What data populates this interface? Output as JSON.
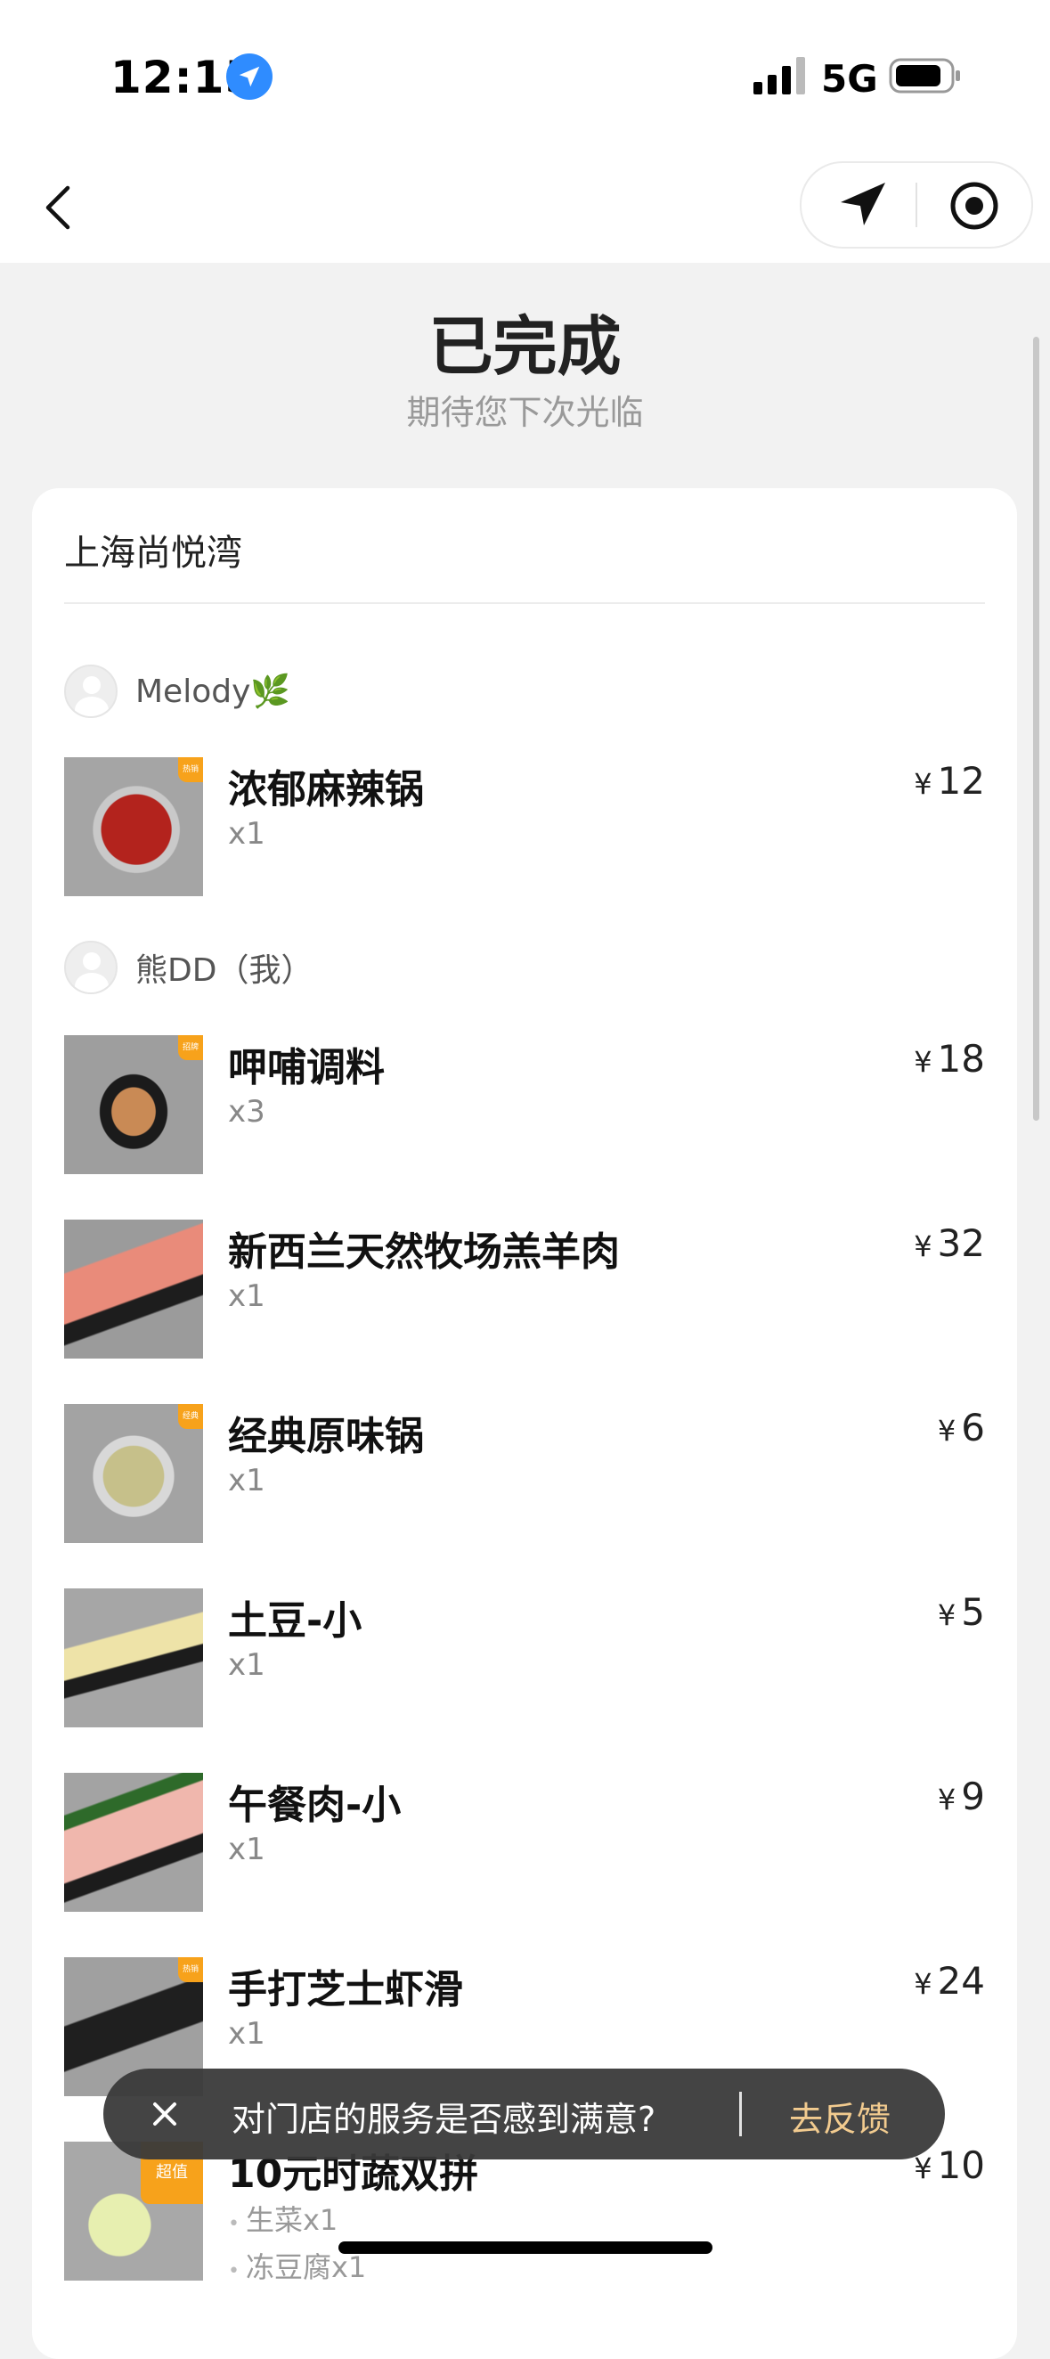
{
  "status": {
    "time": "12:15",
    "network": "5G"
  },
  "header": {
    "title": "已完成",
    "subtitle": "期待您下次光临"
  },
  "store": {
    "name": "上海尚悦湾"
  },
  "users": [
    {
      "name": "Melody🌿"
    },
    {
      "name": "熊DD（我）"
    }
  ],
  "currency": "¥",
  "items": [
    {
      "name": "浓郁麻辣锅",
      "qty": "x1",
      "price": "12",
      "tag": "热销"
    },
    {
      "name": "呷哺调料",
      "qty": "x3",
      "price": "18",
      "tag": "招牌"
    },
    {
      "name": "新西兰天然牧场羔羊肉",
      "qty": "x1",
      "price": "32"
    },
    {
      "name": "经典原味锅",
      "qty": "x1",
      "price": "6",
      "tag": "经典"
    },
    {
      "name": "土豆-小",
      "qty": "x1",
      "price": "5"
    },
    {
      "name": "午餐肉-小",
      "qty": "x1",
      "price": "9"
    },
    {
      "name": "手打芝士虾滑",
      "qty": "x1",
      "price": "24",
      "tag": "热销"
    },
    {
      "name": "10元时蔬双拼",
      "price": "10",
      "tag": "超值",
      "subitems": [
        "生菜x1",
        "冻豆腐x1"
      ]
    }
  ],
  "toast": {
    "text": "对门店的服务是否感到满意?",
    "action": "去反馈"
  },
  "colors": {
    "accent": "#f7a21b",
    "toast_link": "#f2c98a",
    "location_badge": "#2f8cff"
  }
}
